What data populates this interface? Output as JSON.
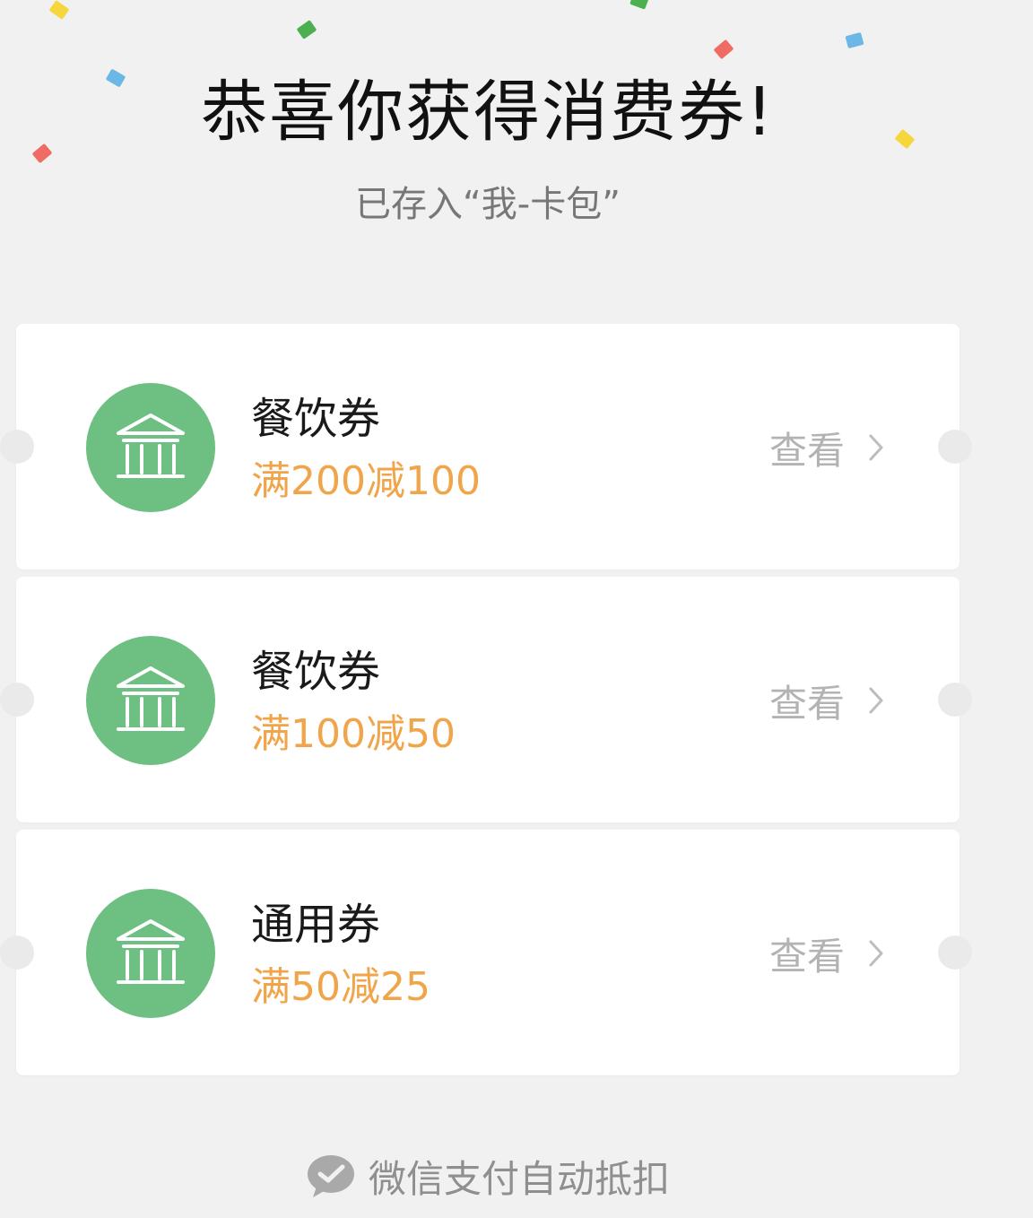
{
  "header": {
    "title": "恭喜你获得消费券!",
    "subtitle": "已存入“我-卡包”"
  },
  "coupons": [
    {
      "name": "餐饮券",
      "rule": "满200减100",
      "action_label": "查看",
      "icon": "bank-icon"
    },
    {
      "name": "餐饮券",
      "rule": "满100减50",
      "action_label": "查看",
      "icon": "bank-icon"
    },
    {
      "name": "通用券",
      "rule": "满50减25",
      "action_label": "查看",
      "icon": "bank-icon"
    }
  ],
  "footer": {
    "text": "微信支付自动抵扣",
    "icon": "wechat-pay-icon"
  },
  "colors": {
    "background": "#f1f1f1",
    "badge": "#6dbf82",
    "rule_text": "#f0a54a",
    "muted_text": "#b3b3b3",
    "confetti": [
      "#f5d63d",
      "#4caf50",
      "#6ab7e8",
      "#ef6b63"
    ]
  }
}
